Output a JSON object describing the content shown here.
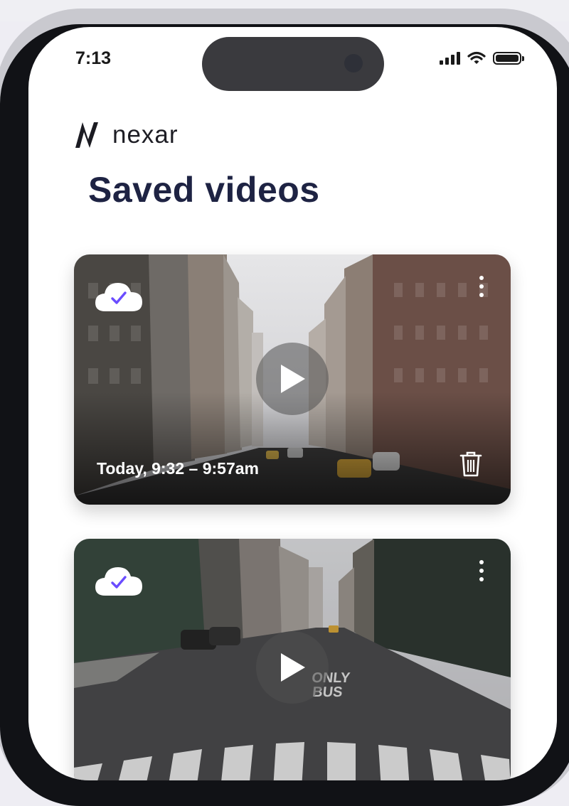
{
  "status_bar": {
    "time": "7:13",
    "icons": [
      "signal-icon",
      "wifi-icon",
      "battery-icon"
    ]
  },
  "brand": {
    "name": "nexar",
    "logo_icon": "nexar-logo-icon"
  },
  "page": {
    "title": "Saved videos"
  },
  "videos": [
    {
      "time_range": "Today, 9:32 – 9:57am",
      "badge_icon": "cloud-check-icon",
      "menu_icon": "kebab-menu-icon",
      "play_icon": "play-icon",
      "delete_icon": "trash-icon"
    },
    {
      "time_range": "",
      "badge_icon": "cloud-check-icon",
      "menu_icon": "kebab-menu-icon",
      "play_icon": "play-icon"
    }
  ],
  "colors": {
    "title": "#1e2343",
    "check_accent": "#6a4cff",
    "frame": "#111216"
  }
}
